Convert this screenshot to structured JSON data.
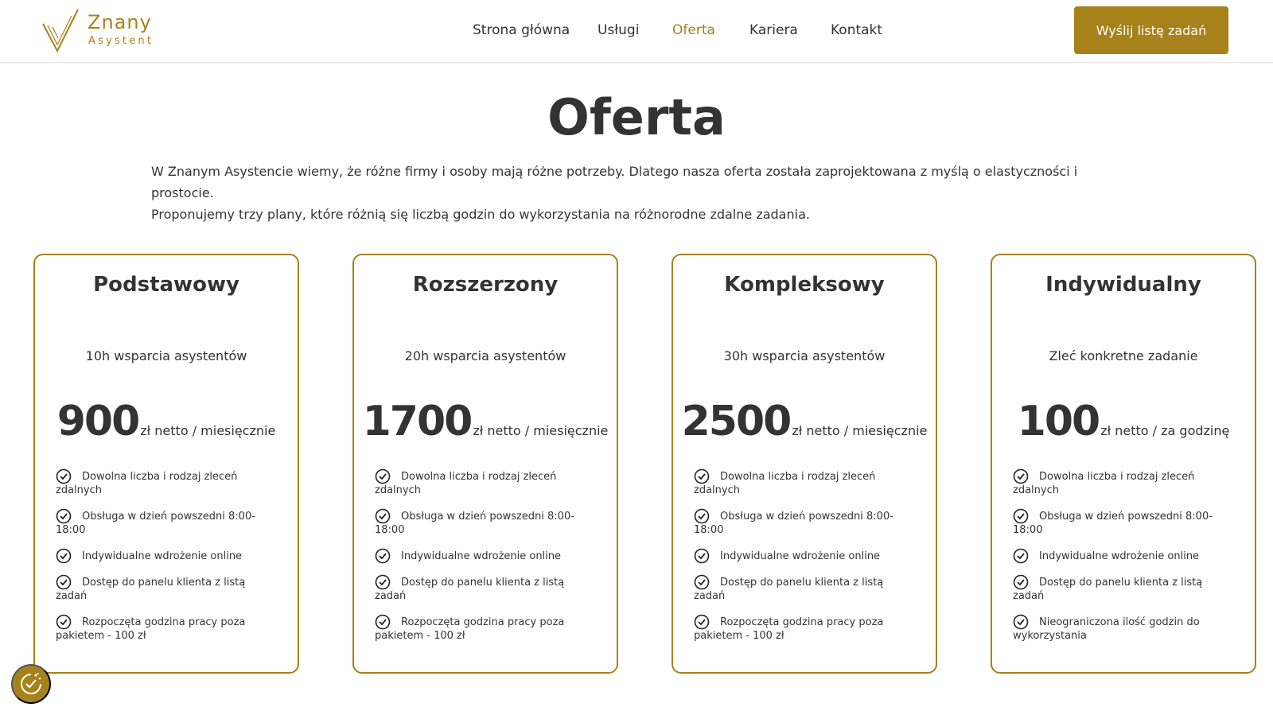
{
  "brand": {
    "name": "Znany",
    "sub": "Asystent",
    "accent": "#a7821b"
  },
  "nav": {
    "items": [
      {
        "label": "Strona główna",
        "active": false
      },
      {
        "label": "Usługi",
        "active": false
      },
      {
        "label": "Oferta",
        "active": true
      },
      {
        "label": "Kariera",
        "active": false
      },
      {
        "label": "Kontakt",
        "active": false
      }
    ]
  },
  "cta": {
    "label": "Wyślij listę zadań"
  },
  "page": {
    "title": "Oferta",
    "intro_line1": "W Znanym Asystencie wiemy, że różne firmy i osoby mają różne potrzeby. Dlatego nasza oferta została zaprojektowana z myślą o elastyczności i prostocie.",
    "intro_line2": "Proponujemy trzy plany, które różnią się liczbą godzin do wykorzystania na różnorodne zdalne zadania."
  },
  "plans": [
    {
      "name": "Podstawowy",
      "sub": "10h wsparcia asystentów",
      "price": "900",
      "unit": "zł netto / miesięcznie",
      "features": [
        "Dowolna liczba i rodzaj zleceń zdalnych",
        "Obsługa w dzień powszedni 8:00-18:00",
        "Indywidualne wdrożenie online",
        "Dostęp do panelu klienta z listą zadań",
        "Rozpoczęta godzina pracy poza pakietem - 100 zł"
      ]
    },
    {
      "name": "Rozszerzony",
      "sub": "20h wsparcia asystentów",
      "price": "1700",
      "unit": "zł netto / miesięcznie",
      "features": [
        "Dowolna liczba i rodzaj zleceń zdalnych",
        "Obsługa w dzień powszedni 8:00-18:00",
        "Indywidualne wdrożenie online",
        "Dostęp do panelu klienta z listą zadań",
        "Rozpoczęta godzina pracy poza pakietem - 100 zł"
      ]
    },
    {
      "name": "Kompleksowy",
      "sub": "30h wsparcia asystentów",
      "price": "2500",
      "unit": "zł netto / miesięcznie",
      "features": [
        "Dowolna liczba i rodzaj zleceń zdalnych",
        "Obsługa w dzień powszedni 8:00-18:00",
        "Indywidualne wdrożenie online",
        "Dostęp do panelu klienta z listą zadań",
        "Rozpoczęta godzina pracy poza pakietem - 100 zł"
      ]
    },
    {
      "name": "Indywidualny",
      "sub": "Zleć konkretne zadanie",
      "price": "100",
      "unit": "zł netto / za godzinę",
      "features": [
        "Dowolna liczba i rodzaj zleceń zdalnych",
        "Obsługa w dzień powszedni 8:00-18:00",
        "Indywidualne wdrożenie online",
        "Dostęp do panelu klienta z listą zadań",
        "Nieograniczona ilość godzin do wykorzystania"
      ]
    }
  ],
  "icons": {
    "logo": "checkmark-logo-icon",
    "feature": "check-circle-icon",
    "badge": "cookie-consent-icon"
  }
}
